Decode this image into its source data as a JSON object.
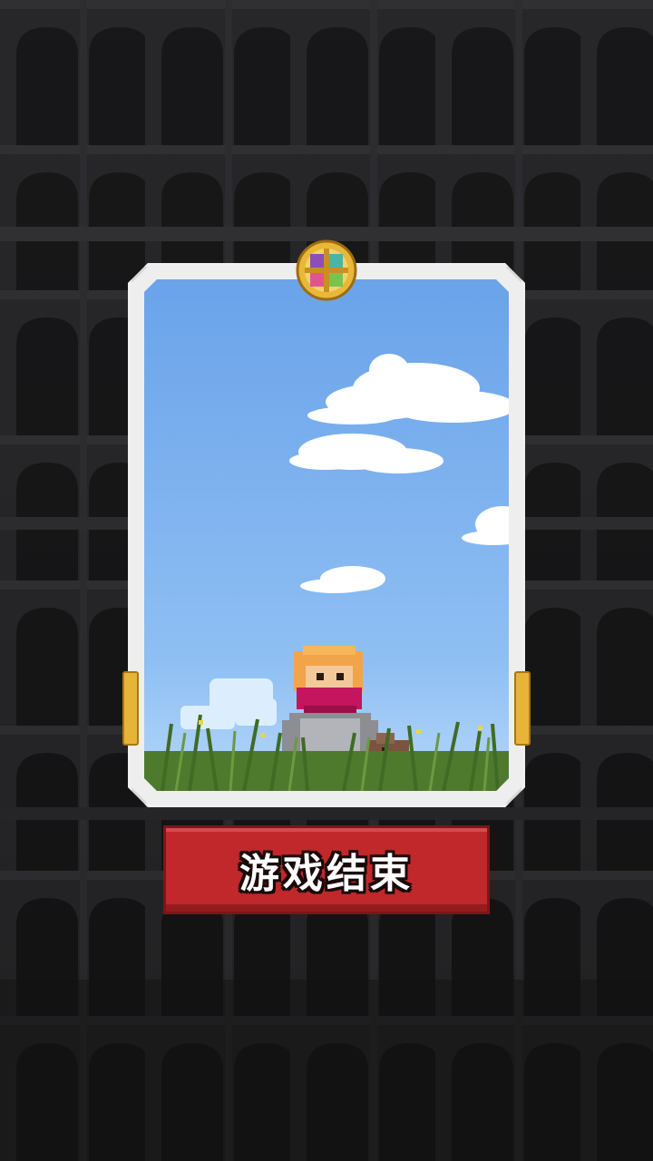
{
  "screen": "game-over",
  "card": {
    "frame_color": "#eeeeee",
    "sky_top": "#6aa3ea",
    "sky_bottom": "#b5d7fa",
    "emblem_icon": "compass-emblem-icon",
    "hero_icon": "masked-hero-icon",
    "pet_icon": "brown-pet-icon"
  },
  "button": {
    "label": "游戏结束",
    "color": "#c0282b"
  },
  "background": {
    "color": "#1c1c1e",
    "pattern": "castle-arches"
  }
}
